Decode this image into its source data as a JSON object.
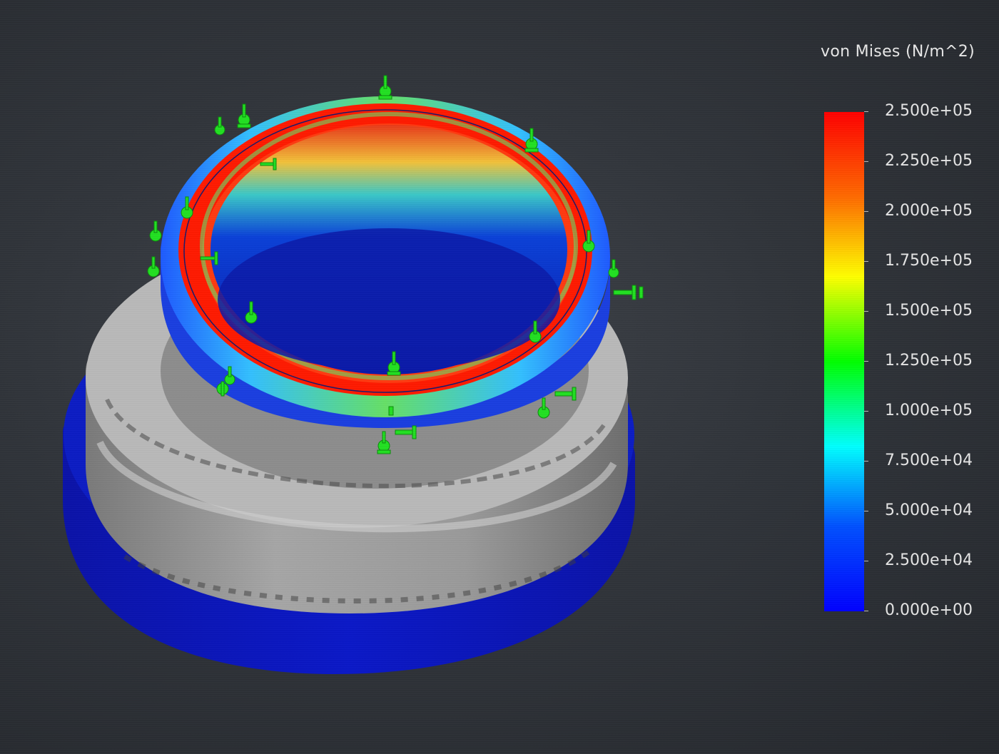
{
  "legend": {
    "title": "von Mises (N/m^2)",
    "ticks": [
      "2.500e+05",
      "2.250e+05",
      "2.000e+05",
      "1.750e+05",
      "1.500e+05",
      "1.250e+05",
      "1.000e+05",
      "7.500e+04",
      "5.000e+04",
      "2.500e+04",
      "0.000e+00"
    ],
    "gradient": [
      "#ff0000",
      "#ff6a00",
      "#ffff00",
      "#00ff00",
      "#00ffff",
      "#0050ff",
      "#0000ff"
    ]
  },
  "colors": {
    "background": "#2b2e33",
    "fixture_marker": "#22e022",
    "base_flange": "#0a14b8",
    "gray_body": "#a9a9a9"
  },
  "icons": {
    "fixture_marker": "fixture-arrow-icon"
  }
}
